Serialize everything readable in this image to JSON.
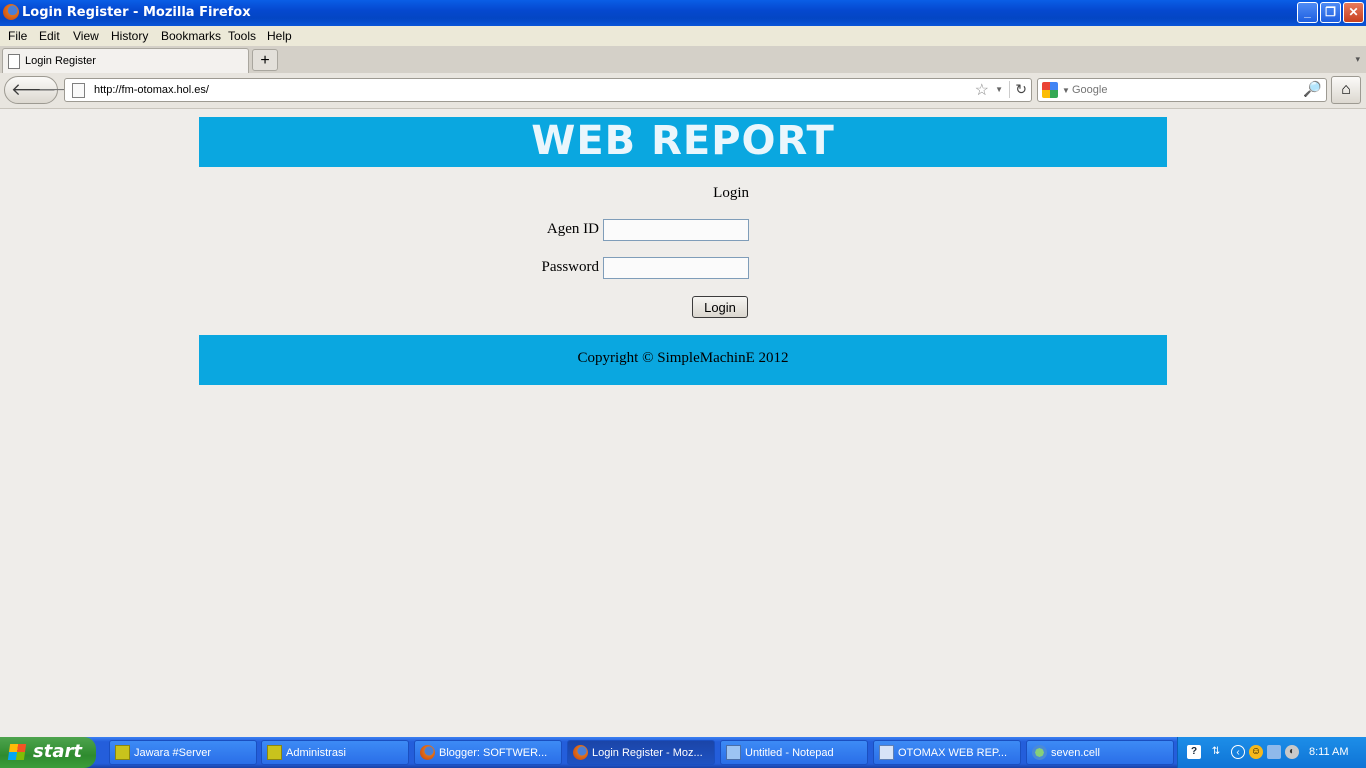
{
  "window": {
    "title": "Login Register - Mozilla Firefox"
  },
  "menu": [
    "File",
    "Edit",
    "View",
    "History",
    "Bookmarks",
    "Tools",
    "Help"
  ],
  "tab": {
    "label": "Login Register",
    "new_tab": "+"
  },
  "nav": {
    "url": "http://fm-otomax.hol.es/",
    "search_placeholder": "Google"
  },
  "page": {
    "header": "WEB REPORT",
    "login_title": "Login",
    "agen_id_label": "Agen ID",
    "agen_id_value": "",
    "password_label": "Password",
    "password_value": "",
    "login_button": "Login",
    "footer": "Copyright © SimpleMachinE 2012",
    "header_color": "#0aa7e0"
  },
  "taskbar": {
    "start": "start",
    "tasks": [
      {
        "label": "Jawara #Server",
        "icon": "jawara-icon"
      },
      {
        "label": "Administrasi",
        "icon": "jawara-icon"
      },
      {
        "label": "Blogger: SOFTWER...",
        "icon": "firefox-icon"
      },
      {
        "label": "Login Register - Moz...",
        "icon": "firefox-icon",
        "active": true
      },
      {
        "label": "Untitled - Notepad",
        "icon": "notepad-icon"
      },
      {
        "label": "OTOMAX WEB REP...",
        "icon": "window-icon"
      },
      {
        "label": "seven.cell",
        "icon": "network-icon"
      }
    ],
    "clock": "8:11 AM"
  }
}
